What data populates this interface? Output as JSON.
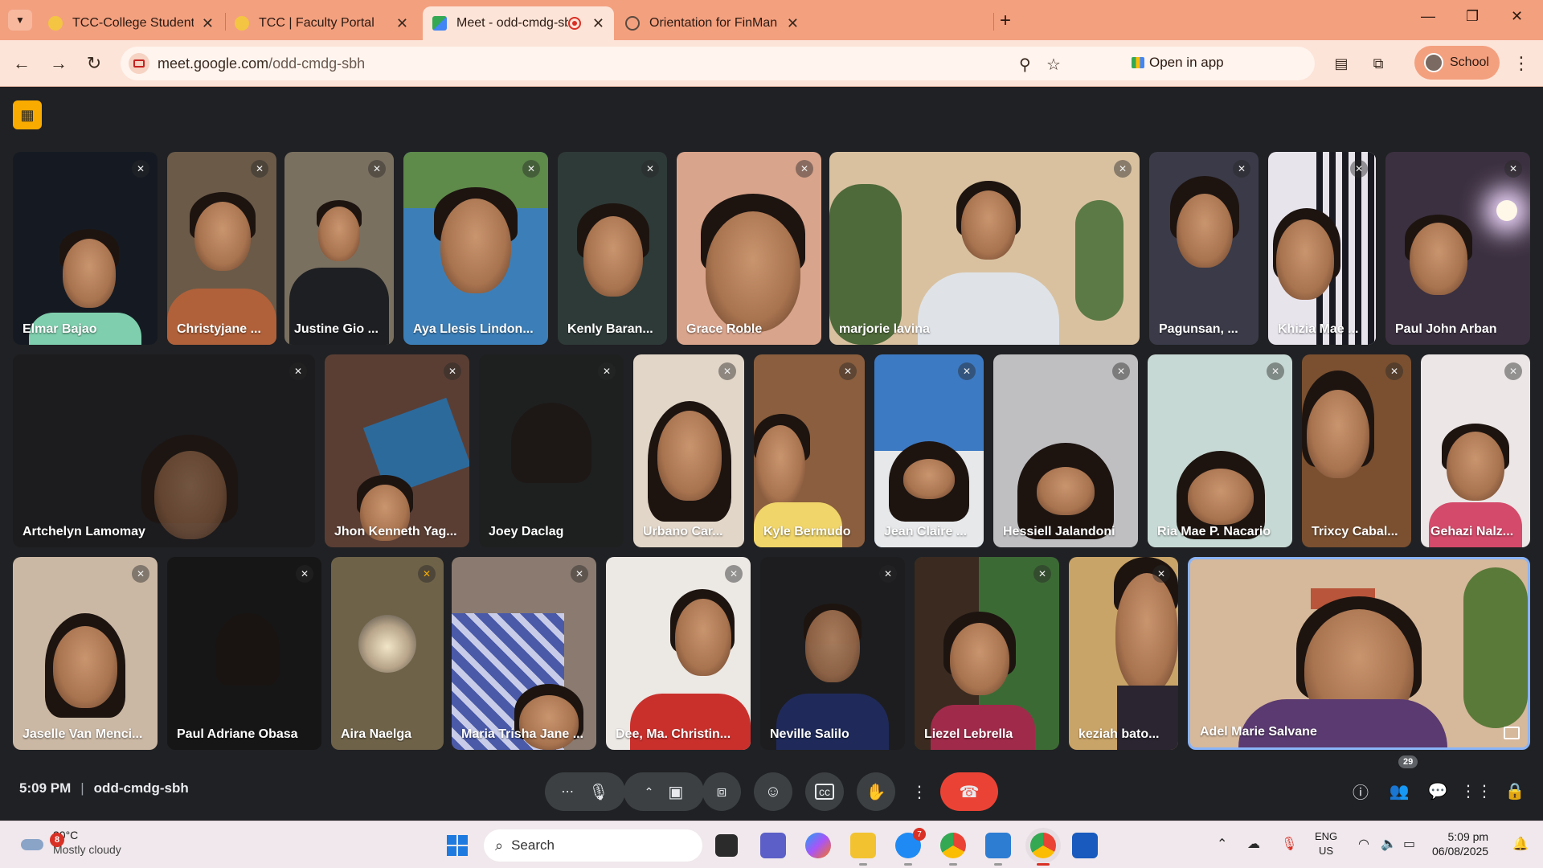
{
  "browser": {
    "tabs": [
      {
        "title": "TCC-College Student Enrolled",
        "active": false
      },
      {
        "title": "TCC | Faculty Portal",
        "active": false
      },
      {
        "title": "Meet - odd-cmdg-sbh",
        "active": true,
        "recording": true
      },
      {
        "title": "Orientation for FinMan",
        "active": false
      }
    ],
    "url_host": "meet.google.com",
    "url_path": "/odd-cmdg-sbh",
    "open_in_app_label": "Open in app",
    "profile_label": "School"
  },
  "participants": [
    {
      "name": "Elmar Bajao"
    },
    {
      "name": "Christyjane ..."
    },
    {
      "name": "Justine Gio ..."
    },
    {
      "name": "Aya Llesis Lindon..."
    },
    {
      "name": "Kenly Baran..."
    },
    {
      "name": "Grace Roble"
    },
    {
      "name": "marjorie lavina"
    },
    {
      "name": "Pagunsan, ..."
    },
    {
      "name": "Khizia Mae ..."
    },
    {
      "name": "Paul John Arban"
    },
    {
      "name": "Artchelyn Lamomay"
    },
    {
      "name": "Jhon Kenneth Yag..."
    },
    {
      "name": "Joey Daclag"
    },
    {
      "name": "Urbano Car..."
    },
    {
      "name": "Kyle Bermudo"
    },
    {
      "name": "Jean Claire ..."
    },
    {
      "name": "Hessiell Jalandoni"
    },
    {
      "name": "Ria Mae P. Nacario"
    },
    {
      "name": "Trixcy Cabal..."
    },
    {
      "name": "Gehazi Nalz..."
    },
    {
      "name": "Jaselle Van Menci..."
    },
    {
      "name": "Paul Adriane Obasa"
    },
    {
      "name": "Aira Naelga"
    },
    {
      "name": "Maria Trisha Jane ..."
    },
    {
      "name": "Dee, Ma. Christin..."
    },
    {
      "name": "Neville Salilo"
    },
    {
      "name": "Liezel Lebrella"
    },
    {
      "name": "keziah bato..."
    },
    {
      "name": "Adel Marie Salvane"
    }
  ],
  "meeting": {
    "time": "5:09 PM",
    "code": "odd-cmdg-sbh",
    "participant_count": "29"
  },
  "taskbar": {
    "weather_temp": "30°C",
    "weather_desc": "Mostly cloudy",
    "weather_badge": "8",
    "search_label": "Search",
    "messenger_badge": "7",
    "lang_line1": "ENG",
    "lang_line2": "US",
    "time": "5:09 pm",
    "date": "06/08/2025"
  },
  "colors": {
    "tabstrip": "#f3a07f",
    "meet_bg": "#202124",
    "end_call": "#ea4335",
    "pinned_border": "#8ab4f8"
  }
}
